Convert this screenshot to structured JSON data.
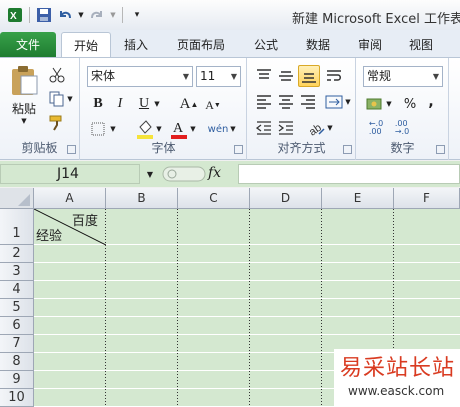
{
  "window": {
    "title": "新建 Microsoft Excel 工作表"
  },
  "quick_access": {
    "icons": [
      "excel-icon",
      "save-icon",
      "undo-icon",
      "redo-icon",
      "customize-icon"
    ]
  },
  "ribbon": {
    "tabs": [
      {
        "label": "文件"
      },
      {
        "label": "开始"
      },
      {
        "label": "插入"
      },
      {
        "label": "页面布局"
      },
      {
        "label": "公式"
      },
      {
        "label": "数据"
      },
      {
        "label": "审阅"
      },
      {
        "label": "视图"
      }
    ],
    "groups": {
      "clipboard": {
        "label": "剪贴板",
        "paste": "粘贴"
      },
      "font": {
        "label": "字体",
        "font_name": "宋体",
        "font_size": "11",
        "bold": "B",
        "italic": "I",
        "underline": "U"
      },
      "alignment": {
        "label": "对齐方式"
      },
      "number": {
        "label": "数字",
        "format": "常规"
      }
    }
  },
  "formula_bar": {
    "name_box": "J14",
    "fx": "fx",
    "value": ""
  },
  "sheet": {
    "columns": [
      "A",
      "B",
      "C",
      "D",
      "E",
      "F"
    ],
    "rows": [
      "1",
      "2",
      "3",
      "4",
      "5",
      "6",
      "7",
      "8",
      "9",
      "10"
    ],
    "cell_a1": {
      "top_right": "百度",
      "bottom_left": "经验"
    }
  },
  "watermark": {
    "title": "易采站长站",
    "url": "www.easck.com"
  },
  "colors": {
    "file_tab": "#2a8c3c",
    "grid_background": "#d4e8d0",
    "watermark_red": "#d93b21"
  }
}
